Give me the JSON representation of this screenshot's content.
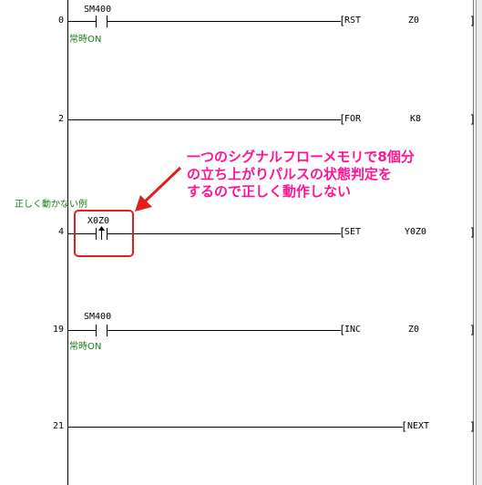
{
  "rungs": [
    {
      "step": "0",
      "contact_device": "SM400",
      "contact_comment": "常時ON",
      "instruction": "RST",
      "operand": "Z0"
    },
    {
      "step": "2",
      "instruction": "FOR",
      "operand": "K8"
    },
    {
      "step": "4",
      "contact_device": "X0Z0",
      "instruction": "SET",
      "operand": "Y0Z0"
    },
    {
      "step": "19",
      "contact_device": "SM400",
      "contact_comment": "常時ON",
      "instruction": "INC",
      "operand": "Z0"
    },
    {
      "step": "21",
      "instruction": "NEXT"
    }
  ],
  "bad_example_label": "正しく動かない例",
  "callout": {
    "line1": "一つのシグナルフローメモリで8個分",
    "line2": "の立ち上がりパルスの状態判定を",
    "line3": "するので正しく動作しない"
  },
  "colors": {
    "comment": "#1a7a1a",
    "callout": "#ff1493",
    "highlight": "#e02020",
    "arrow": "#e02020"
  }
}
